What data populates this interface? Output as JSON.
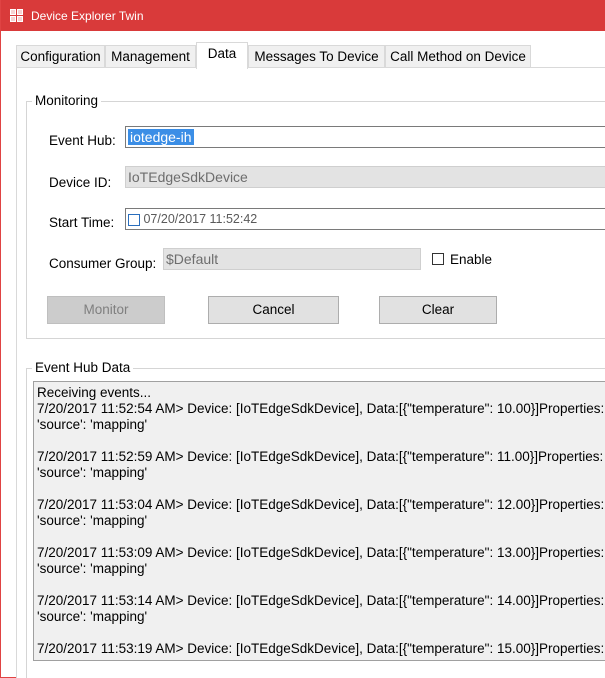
{
  "window": {
    "title": "Device Explorer Twin"
  },
  "tabs": [
    {
      "label": "Configuration",
      "active": false
    },
    {
      "label": "Management",
      "active": false
    },
    {
      "label": "Data",
      "active": true
    },
    {
      "label": "Messages To Device",
      "active": false
    },
    {
      "label": "Call Method on Device",
      "active": false
    }
  ],
  "monitoring": {
    "group_label": "Monitoring",
    "event_hub_label": "Event Hub:",
    "event_hub_value": "iotedge-ih",
    "device_id_label": "Device ID:",
    "device_id_value": "IoTEdgeSdkDevice",
    "start_time_label": "Start Time:",
    "start_time_value": "07/20/2017 11:52:42",
    "consumer_group_label": "Consumer Group:",
    "consumer_group_value": "$Default",
    "enable_label": "Enable",
    "buttons": {
      "monitor": "Monitor",
      "cancel": "Cancel",
      "clear": "Clear"
    }
  },
  "event_hub_data": {
    "group_label": "Event Hub Data",
    "header": "Receiving events...",
    "entries": [
      "7/20/2017 11:52:54 AM> Device: [IoTEdgeSdkDevice], Data:[{\"temperature\": 10.00}]Properties:\n'source': 'mapping'",
      "7/20/2017 11:52:59 AM> Device: [IoTEdgeSdkDevice], Data:[{\"temperature\": 11.00}]Properties:\n'source': 'mapping'",
      "7/20/2017 11:53:04 AM> Device: [IoTEdgeSdkDevice], Data:[{\"temperature\": 12.00}]Properties:\n'source': 'mapping'",
      "7/20/2017 11:53:09 AM> Device: [IoTEdgeSdkDevice], Data:[{\"temperature\": 13.00}]Properties:\n'source': 'mapping'",
      "7/20/2017 11:53:14 AM> Device: [IoTEdgeSdkDevice], Data:[{\"temperature\": 14.00}]Properties:\n'source': 'mapping'",
      "7/20/2017 11:53:19 AM> Device: [IoTEdgeSdkDevice], Data:[{\"temperature\": 15.00}]Properties:"
    ]
  },
  "colors": {
    "titlebar": "#d93a3a",
    "selection": "#3b8ee6"
  }
}
